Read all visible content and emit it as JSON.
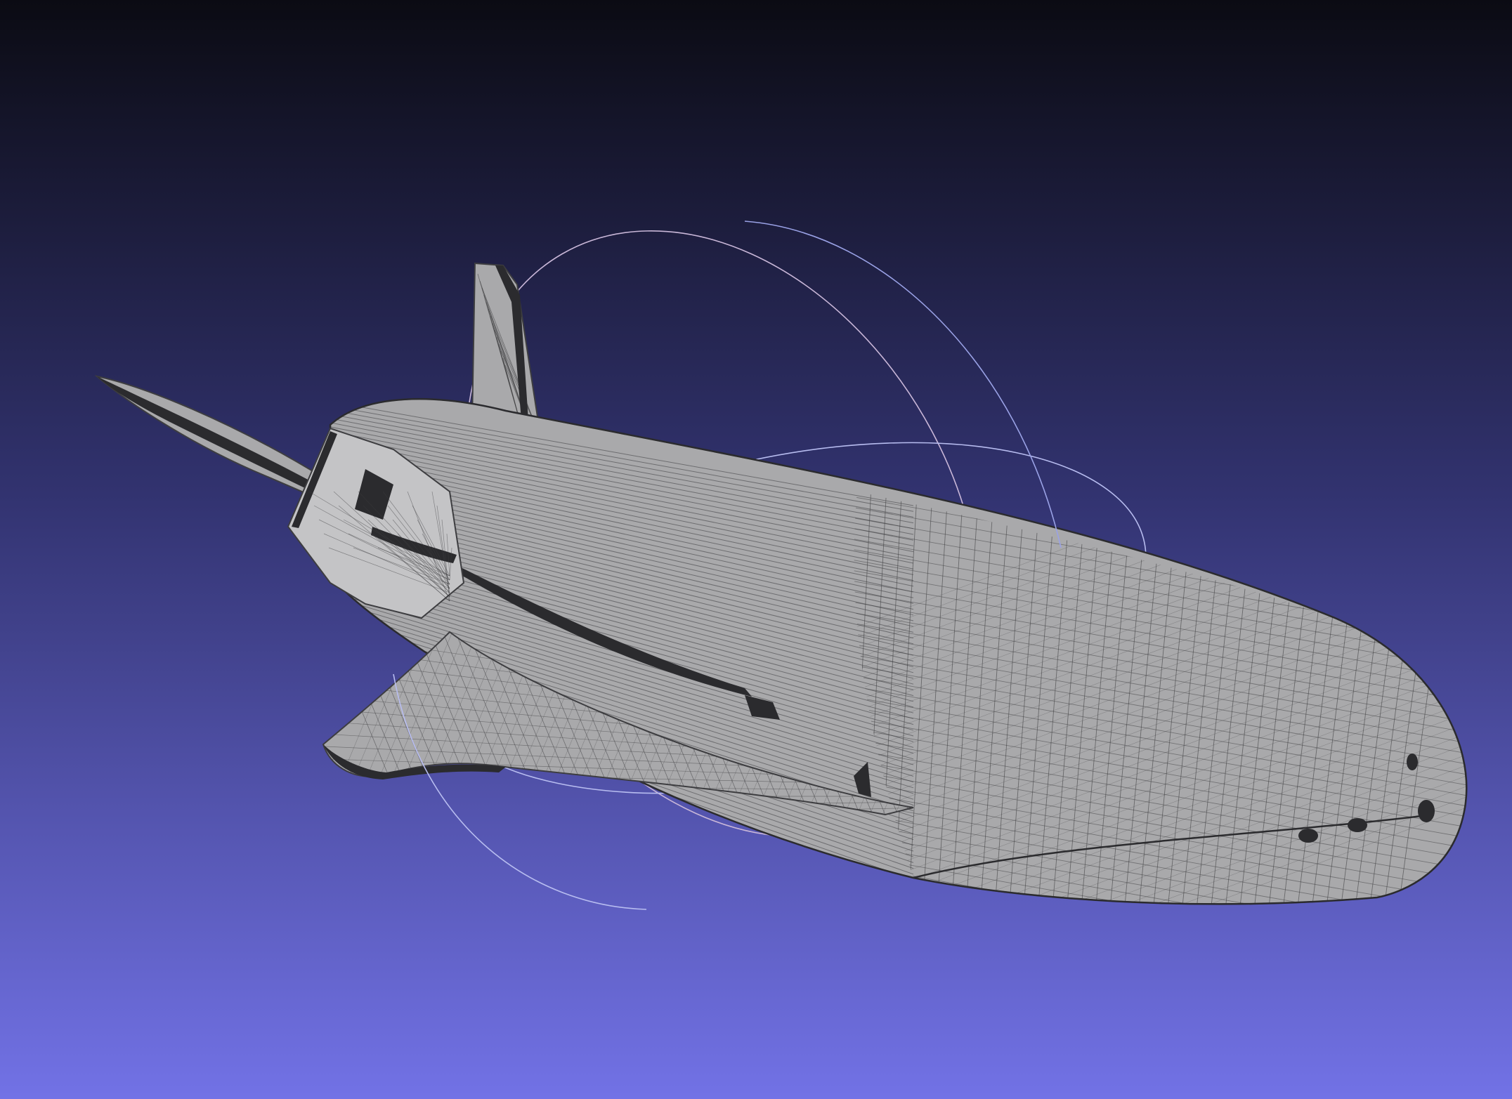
{
  "viewport": {
    "background_top": "#0b0b13",
    "background_mid": "#323370",
    "background_bottom": "#7272e6"
  },
  "model": {
    "mesh_fill": "#a9a9ab",
    "mesh_fill_light": "#c4c4c6",
    "mesh_line": "#3d3d40",
    "mesh_dark": "#2b2b2e"
  },
  "trackball": {
    "ring_color_a": "#c9b7d8",
    "ring_color_b": "#b8bdf0",
    "ring_color_c": "#9aa2e6"
  }
}
